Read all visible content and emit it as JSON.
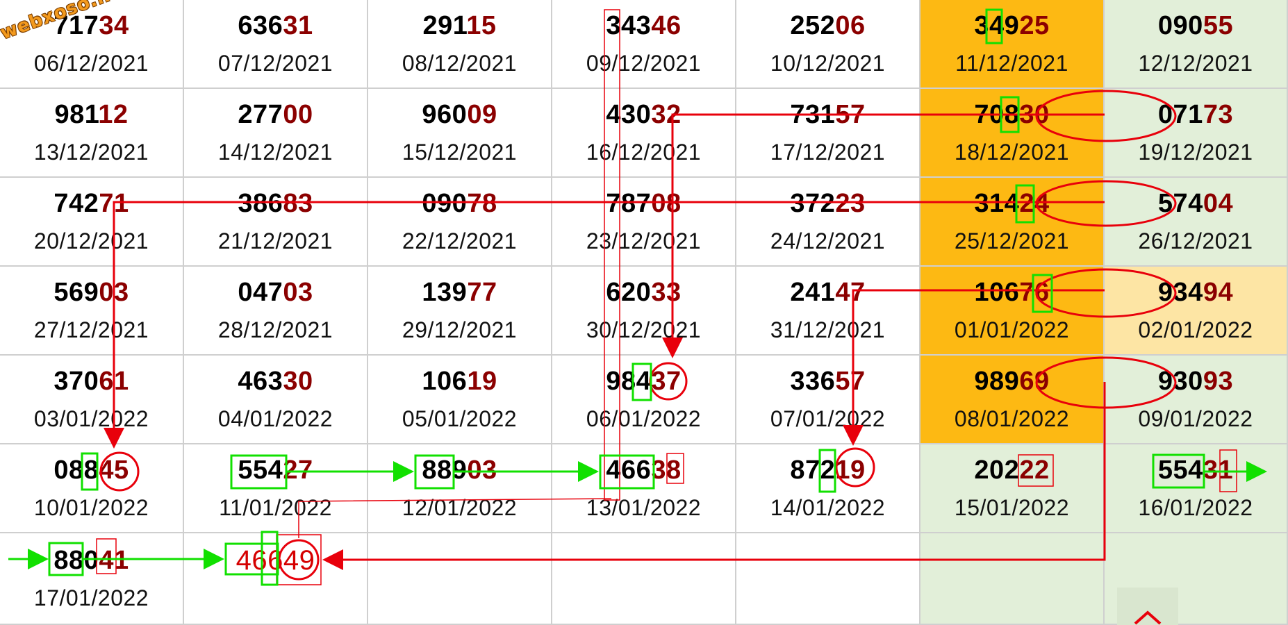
{
  "watermark": "webxoso.net",
  "colors": {
    "highlight_digits": "#8b0000",
    "orange_column": "#fdb913",
    "green_column": "#e2efd9",
    "arrow_red": "#e8000b",
    "arrow_green": "#11e000"
  },
  "grid_rows": [
    [
      {
        "prefix": "717",
        "suffix": "34",
        "date": "06/12/2021"
      },
      {
        "prefix": "636",
        "suffix": "31",
        "date": "07/12/2021"
      },
      {
        "prefix": "291",
        "suffix": "15",
        "date": "08/12/2021"
      },
      {
        "prefix": "343",
        "suffix": "46",
        "date": "09/12/2021"
      },
      {
        "prefix": "252",
        "suffix": "06",
        "date": "10/12/2021"
      },
      {
        "prefix": "349",
        "suffix": "25",
        "date": "11/12/2021",
        "bg": "orange"
      },
      {
        "prefix": "090",
        "suffix": "55",
        "date": "12/12/2021",
        "bg": "green"
      }
    ],
    [
      {
        "prefix": "981",
        "suffix": "12",
        "date": "13/12/2021"
      },
      {
        "prefix": "277",
        "suffix": "00",
        "date": "14/12/2021"
      },
      {
        "prefix": "960",
        "suffix": "09",
        "date": "15/12/2021"
      },
      {
        "prefix": "430",
        "suffix": "32",
        "date": "16/12/2021"
      },
      {
        "prefix": "731",
        "suffix": "57",
        "date": "17/12/2021"
      },
      {
        "prefix": "708",
        "suffix": "30",
        "date": "18/12/2021",
        "bg": "orange"
      },
      {
        "prefix": "071",
        "suffix": "73",
        "date": "19/12/2021",
        "bg": "green"
      }
    ],
    [
      {
        "prefix": "742",
        "suffix": "71",
        "date": "20/12/2021"
      },
      {
        "prefix": "386",
        "suffix": "83",
        "date": "21/12/2021"
      },
      {
        "prefix": "090",
        "suffix": "78",
        "date": "22/12/2021"
      },
      {
        "prefix": "787",
        "suffix": "08",
        "date": "23/12/2021"
      },
      {
        "prefix": "372",
        "suffix": "23",
        "date": "24/12/2021"
      },
      {
        "prefix": "314",
        "suffix": "24",
        "date": "25/12/2021",
        "bg": "orange"
      },
      {
        "prefix": "574",
        "suffix": "04",
        "date": "26/12/2021",
        "bg": "green"
      }
    ],
    [
      {
        "prefix": "569",
        "suffix": "03",
        "date": "27/12/2021"
      },
      {
        "prefix": "047",
        "suffix": "03",
        "date": "28/12/2021"
      },
      {
        "prefix": "139",
        "suffix": "77",
        "date": "29/12/2021"
      },
      {
        "prefix": "620",
        "suffix": "33",
        "date": "30/12/2021"
      },
      {
        "prefix": "241",
        "suffix": "47",
        "date": "31/12/2021"
      },
      {
        "prefix": "106",
        "suffix": "76",
        "date": "01/01/2022",
        "bg": "orange"
      },
      {
        "prefix": "934",
        "suffix": "94",
        "date": "02/01/2022",
        "bg": "lightorange"
      }
    ],
    [
      {
        "prefix": "370",
        "suffix": "61",
        "date": "03/01/2022"
      },
      {
        "prefix": "463",
        "suffix": "30",
        "date": "04/01/2022"
      },
      {
        "prefix": "106",
        "suffix": "19",
        "date": "05/01/2022"
      },
      {
        "prefix": "984",
        "suffix": "37",
        "date": "06/01/2022"
      },
      {
        "prefix": "336",
        "suffix": "57",
        "date": "07/01/2022"
      },
      {
        "prefix": "989",
        "suffix": "69",
        "date": "08/01/2022",
        "bg": "orange"
      },
      {
        "prefix": "930",
        "suffix": "93",
        "date": "09/01/2022",
        "bg": "green"
      }
    ],
    [
      {
        "prefix": "088",
        "suffix": "45",
        "date": "10/01/2022"
      },
      {
        "prefix": "554",
        "suffix": "27",
        "date": "11/01/2022"
      },
      {
        "prefix": "889",
        "suffix": "03",
        "date": "12/01/2022"
      },
      {
        "prefix": "466",
        "suffix": "38",
        "date": "13/01/2022"
      },
      {
        "prefix": "872",
        "suffix": "19",
        "date": "14/01/2022"
      },
      {
        "prefix": "202",
        "suffix": "22",
        "date": "15/01/2022",
        "bg": "green"
      },
      {
        "prefix": "554",
        "suffix": "31",
        "date": "16/01/2022",
        "bg": "green"
      }
    ],
    [
      {
        "prefix": "880",
        "suffix": "41",
        "date": "17/01/2022"
      },
      {
        "prefix": "466",
        "suffix": "49",
        "date": "",
        "special": true
      },
      {
        "prefix": "",
        "suffix": "",
        "date": ""
      },
      {
        "prefix": "",
        "suffix": "",
        "date": ""
      },
      {
        "prefix": "",
        "suffix": "",
        "date": ""
      },
      {
        "prefix": "",
        "suffix": "",
        "date": "",
        "bg": "green"
      },
      {
        "prefix": "",
        "suffix": "",
        "date": "",
        "bg": "green"
      }
    ]
  ],
  "scroll_top_icon": "chevron-up-icon"
}
